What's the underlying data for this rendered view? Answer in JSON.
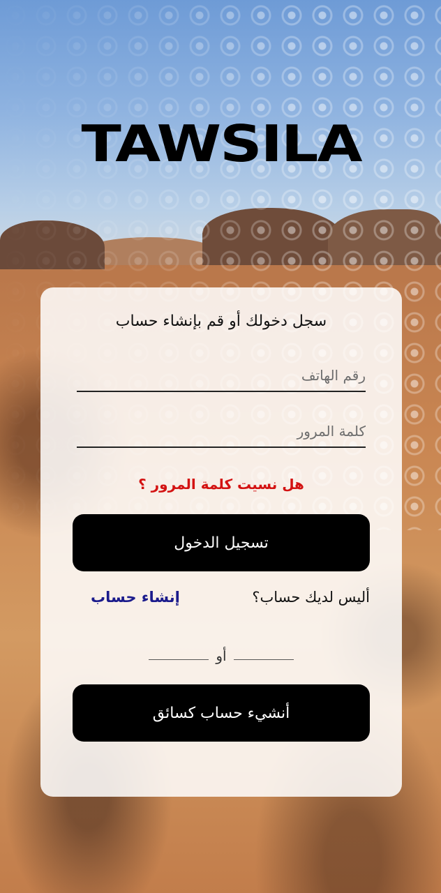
{
  "brand": {
    "logo_text": "TAWSILA"
  },
  "login_card": {
    "title": "سجل دخولك أو قم بإنشاء حساب",
    "phone_placeholder": "رقم الهاتف",
    "password_placeholder": "كلمة المرور",
    "forgot_password": "هل نسيت كلمة المرور ؟",
    "login_button": "تسجيل الدخول",
    "no_account_text": "أليس لديك حساب؟",
    "create_account_link": "إنشاء حساب",
    "or_text": "أو",
    "create_driver_button": "أنشيء حساب كسائق"
  },
  "colors": {
    "primary_button": "#000000",
    "forgot_link": "#d31212",
    "create_link": "#1b1b8c"
  }
}
